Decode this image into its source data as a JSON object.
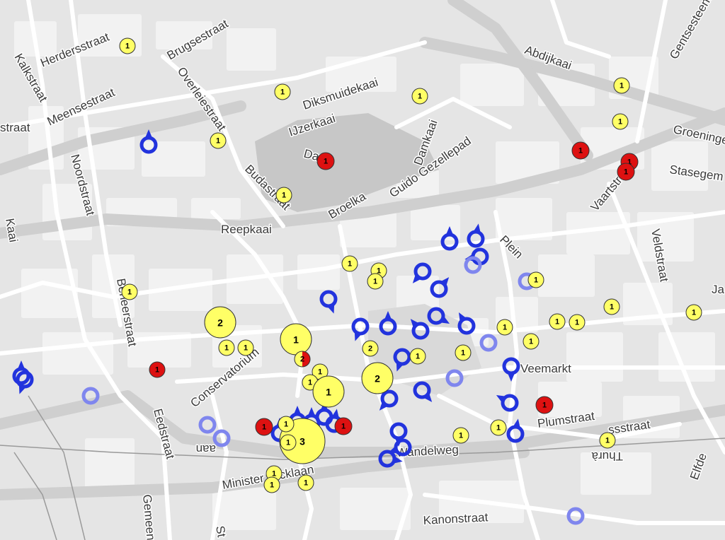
{
  "map": {
    "colors": {
      "background": "#e5e5e5",
      "block": "#f2f2f2",
      "road": "#ffffff",
      "major_road": "#cfcfcf",
      "water_area": "#c7c7c7",
      "rail": "#9a9a9a",
      "yellow_marker": "#ffff66",
      "red_marker": "#dd1111",
      "blue_marker": "#2233dd",
      "faded_blue_marker": "#7f86ee"
    },
    "street_labels": [
      {
        "id": "hendrikstraat-top",
        "text": "Herdersstraat"
      },
      {
        "id": "kalkstraat",
        "text": "Kalkstraat"
      },
      {
        "id": "meensestraat",
        "text": "Meensestraat"
      },
      {
        "id": "brugsestraat",
        "text": "Brugsestraat"
      },
      {
        "id": "overleiestraat",
        "text": "Overleiestraat"
      },
      {
        "id": "diksmuidekaai",
        "text": "Diksmuidekaai"
      },
      {
        "id": "ijzerkaai",
        "text": "IJzerkaai"
      },
      {
        "id": "abdijkaai",
        "text": "Abdijkaai"
      },
      {
        "id": "gentsesteenweg",
        "text": "Gentsesteenweg"
      },
      {
        "id": "groeninge",
        "text": "Groeninge"
      },
      {
        "id": "stasegemsesteenweg",
        "text": "Stasegem"
      },
      {
        "id": "damkaai",
        "text": "Damkaai"
      },
      {
        "id": "guido-gezellepad",
        "text": "Guido Gezellepad"
      },
      {
        "id": "broelkaai",
        "text": "Broelka"
      },
      {
        "id": "budastraat",
        "text": "Budastraat"
      },
      {
        "id": "dam",
        "text": "Dam"
      },
      {
        "id": "reepkaai",
        "text": "Reepkaai"
      },
      {
        "id": "noordstraat",
        "text": "Noordstraat"
      },
      {
        "id": "kaai",
        "text": "Kaai"
      },
      {
        "id": "beheerstraat",
        "text": "Beheerstraat"
      },
      {
        "id": "vaartstraat",
        "text": "Vaartstraat"
      },
      {
        "id": "veldstraat",
        "text": "Veldstraat"
      },
      {
        "id": "plein",
        "text": "Plein"
      },
      {
        "id": "veemarkt",
        "text": "Veemarkt"
      },
      {
        "id": "plumstraat",
        "text": "Plumstraat"
      },
      {
        "id": "conservatorium",
        "text": "Conservatorium"
      },
      {
        "id": "wandelweg",
        "text": "Wandelweg"
      },
      {
        "id": "ministerlaan",
        "text": "Minister Tacklaan"
      },
      {
        "id": "kanonstraat",
        "text": "Kanonstraat"
      },
      {
        "id": "eedstraat",
        "text": "Eedstraat"
      },
      {
        "id": "gemeente",
        "text": "Gemeente"
      },
      {
        "id": "straat-left",
        "text": "straat"
      },
      {
        "id": "ja-right",
        "text": "Ja"
      },
      {
        "id": "ssstraat",
        "text": "ssstraat"
      },
      {
        "id": "thura",
        "text": "Thurà"
      },
      {
        "id": "elfde",
        "text": "Elfde"
      },
      {
        "id": "st-bottom",
        "text": "St"
      },
      {
        "id": "aan",
        "text": "aan"
      }
    ],
    "markers": [
      {
        "color": "yellow",
        "count": "1"
      },
      {
        "color": "yellow",
        "count": "1"
      },
      {
        "color": "yellow",
        "count": "1"
      },
      {
        "color": "yellow",
        "count": "1"
      },
      {
        "color": "yellow",
        "count": "1"
      },
      {
        "color": "yellow",
        "count": "1"
      },
      {
        "color": "yellow",
        "count": "1"
      },
      {
        "color": "yellow",
        "count": "1"
      },
      {
        "color": "yellow",
        "count": "1"
      },
      {
        "color": "yellow",
        "count": "1"
      },
      {
        "color": "yellow",
        "count": "1"
      },
      {
        "color": "yellow",
        "count": "1"
      },
      {
        "color": "yellow",
        "count": "1"
      },
      {
        "color": "yellow",
        "count": "1"
      },
      {
        "color": "yellow",
        "count": "1"
      },
      {
        "color": "yellow",
        "count": "2"
      },
      {
        "color": "yellow",
        "count": "1"
      },
      {
        "color": "yellow",
        "count": "1"
      },
      {
        "color": "split",
        "count": "2"
      },
      {
        "color": "yellow",
        "count": "1"
      },
      {
        "color": "yellow",
        "count": "1"
      },
      {
        "color": "yellow",
        "count": "1"
      },
      {
        "color": "yellow",
        "count": "2"
      },
      {
        "color": "yellow",
        "count": "2"
      },
      {
        "color": "yellow",
        "count": "1"
      },
      {
        "color": "yellow",
        "count": "1"
      },
      {
        "color": "yellow",
        "count": "1"
      },
      {
        "color": "yellow",
        "count": "1"
      },
      {
        "color": "yellow",
        "count": "1"
      },
      {
        "color": "yellow",
        "count": "1"
      },
      {
        "color": "yellow",
        "count": "3"
      },
      {
        "color": "yellow",
        "count": "1"
      },
      {
        "color": "yellow",
        "count": "1"
      },
      {
        "color": "yellow",
        "count": "1"
      },
      {
        "color": "yellow",
        "count": "1"
      },
      {
        "color": "yellow",
        "count": "1"
      },
      {
        "color": "yellow",
        "count": "1"
      },
      {
        "color": "yellow",
        "count": "1"
      },
      {
        "color": "yellow",
        "count": "1"
      },
      {
        "color": "red",
        "count": "1"
      },
      {
        "color": "red",
        "count": "1"
      },
      {
        "color": "red",
        "count": "1"
      },
      {
        "color": "red",
        "count": "1"
      },
      {
        "color": "red",
        "count": "1"
      },
      {
        "color": "red",
        "count": "1"
      },
      {
        "color": "red",
        "count": "1"
      },
      {
        "color": "red",
        "count": "1"
      }
    ]
  }
}
